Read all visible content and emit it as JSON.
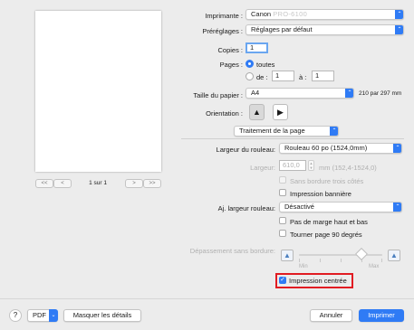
{
  "printer": {
    "label": "Imprimante :",
    "value_prefix": "Canon",
    "value_model": "PRO-6100"
  },
  "presets": {
    "label": "Préréglages :",
    "value": "Réglages par défaut"
  },
  "copies": {
    "label": "Copies :",
    "value": "1"
  },
  "pages": {
    "label": "Pages :",
    "all_label": "toutes",
    "from_label": "de :",
    "from_value": "1",
    "to_label": "à :",
    "to_value": "1"
  },
  "paper_size": {
    "label": "Taille du papier :",
    "value": "A4",
    "dimensions": "210 par 297 mm"
  },
  "orientation": {
    "label": "Orientation :"
  },
  "section": {
    "value": "Traitement de la page"
  },
  "roll_width": {
    "label": "Largeur du rouleau:",
    "value": "Rouleau 60 po (1524,0mm)"
  },
  "width": {
    "label": "Largeur:",
    "value": "610,0",
    "range": "mm (152,4-1524,0)"
  },
  "borderless_three_sides": {
    "label": "Sans bordure trois côtés"
  },
  "banner_printing": {
    "label": "Impression bannière"
  },
  "adjust_roll_width": {
    "label": "Aj. largeur rouleau:",
    "value": "Désactivé"
  },
  "no_top_bottom_margin": {
    "label": "Pas de marge haut et bas"
  },
  "rotate_90": {
    "label": "Tourner page 90 degrés"
  },
  "overflow": {
    "label": "Dépassement sans bordure:",
    "min_label": "Min",
    "max_label": "Max",
    "level": 0.75
  },
  "centered_printing": {
    "label": "Impression centrée",
    "checked": true
  },
  "pager": {
    "label": "1 sur 1",
    "first": "<<",
    "prev": "<",
    "next": ">",
    "last": ">>"
  },
  "footer": {
    "help": "?",
    "pdf_label": "PDF",
    "hide_details": "Masquer les détails",
    "cancel": "Annuler",
    "print": "Imprimer"
  },
  "colors": {
    "accent": "#2f7bf5",
    "highlight": "#e11b22"
  }
}
